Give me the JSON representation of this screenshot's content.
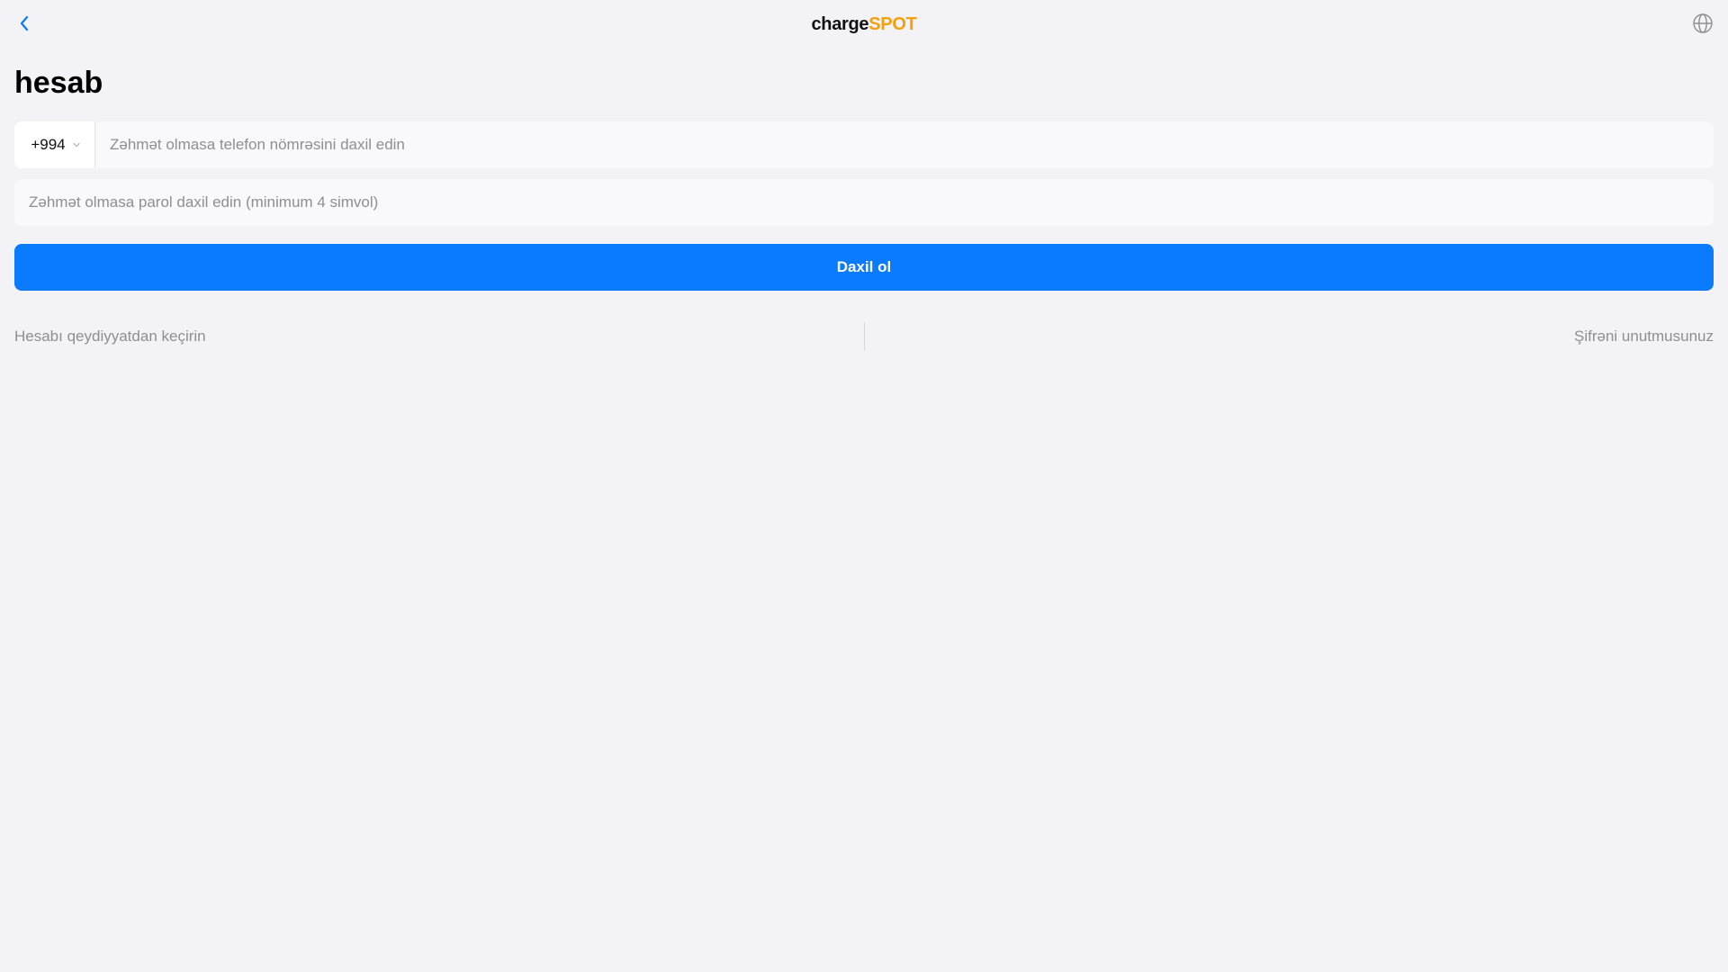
{
  "header": {
    "brand_part1": "charge",
    "brand_part2": "SPOT",
    "back_icon": "chevron-left-icon",
    "language_icon": "globe-icon"
  },
  "title": "hesab",
  "phone": {
    "country_code": "+994",
    "country_dropdown_icon": "chevron-down-icon",
    "value": "",
    "placeholder": "Zəhmət olmasa telefon nömrəsini daxil edin"
  },
  "password": {
    "value": "",
    "placeholder": "Zəhmət olmasa parol daxil edin (minimum 4 simvol)"
  },
  "login_label": "Daxil ol",
  "links": {
    "register": "Hesabı qeydiyyatdan keçirin",
    "forgot": "Şifrəni unutmusunuz"
  },
  "colors": {
    "background": "#f2f2f7",
    "primary": "#0a7bff",
    "brand_accent": "#f5a00a",
    "muted_text": "#8e8e93"
  }
}
